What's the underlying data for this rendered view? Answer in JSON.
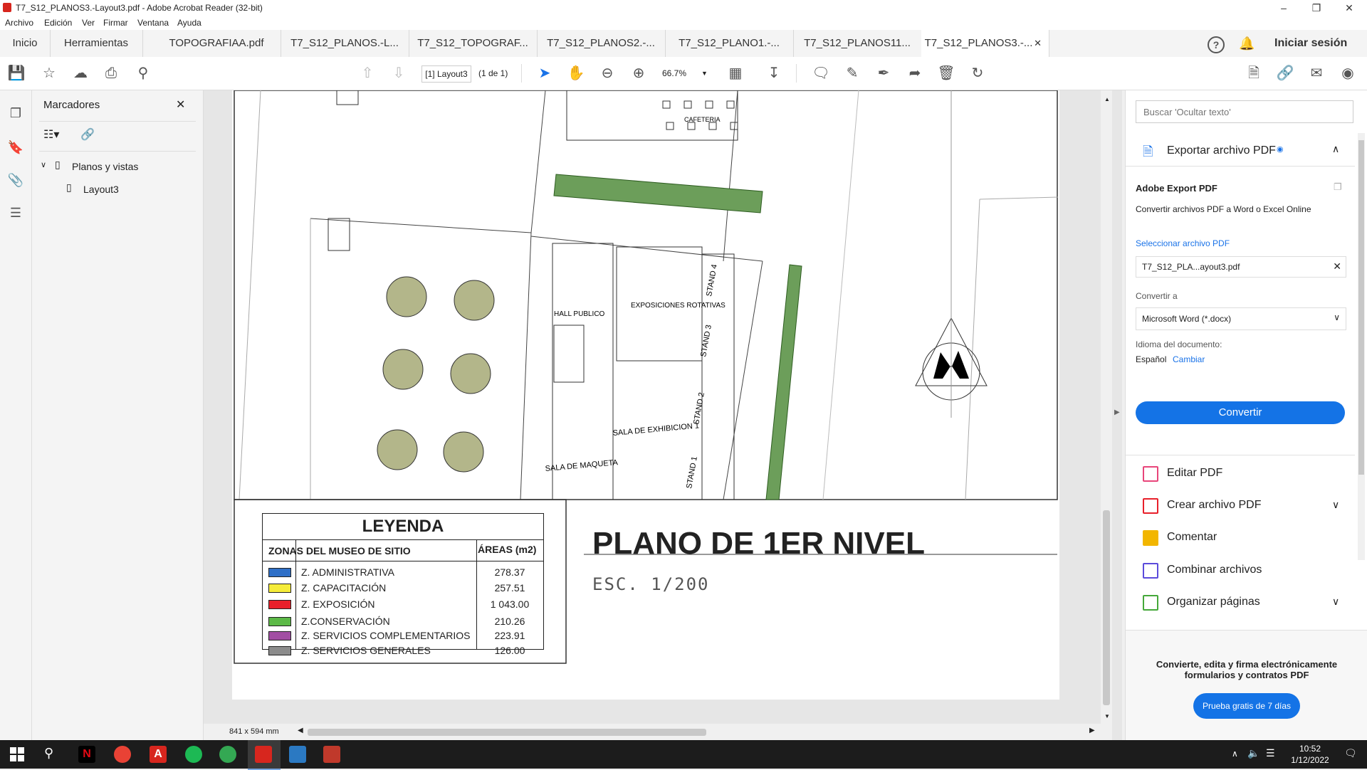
{
  "window": {
    "title": "T7_S12_PLANOS3.-Layout3.pdf - Adobe Acrobat Reader (32-bit)"
  },
  "menu": [
    "Archivo",
    "Edición",
    "Ver",
    "Firmar",
    "Ventana",
    "Ayuda"
  ],
  "tabs": [
    {
      "label": "Inicio"
    },
    {
      "label": "Herramientas"
    },
    {
      "label": "TOPOGRAFIAA.pdf"
    },
    {
      "label": "T7_S12_PLANOS.-L..."
    },
    {
      "label": "T7_S12_TOPOGRAF..."
    },
    {
      "label": "T7_S12_PLANOS2.-..."
    },
    {
      "label": "T7_S12_PLANO1.-..."
    },
    {
      "label": "T7_S12_PLANOS11..."
    },
    {
      "label": "T7_S12_PLANOS3.-..."
    }
  ],
  "header_right": {
    "signin": "Iniciar sesión"
  },
  "toolbar": {
    "page_field": "[1] Layout3",
    "page_count": "(1 de 1)",
    "zoom": "66.7%"
  },
  "bookmarks": {
    "title": "Marcadores",
    "items": [
      {
        "label": "Planos y vistas"
      },
      {
        "label": "Layout3"
      }
    ]
  },
  "plan": {
    "labels": {
      "cafeteria": "CAFETERIA",
      "hall": "HALL PUBLICO",
      "expo": "EXPOSICIONES ROTATIVAS",
      "stand4": "STAND 4",
      "stand3": "STAND 3",
      "stand2": "STAND 2",
      "stand1": "STAND 1",
      "sala_exhib": "SALA DE EXHIBICION 1",
      "sala_maqueta": "SALA DE MAQUETA"
    },
    "title": "PLANO DE 1ER NIVEL",
    "scale": "ESC. 1/200"
  },
  "legend": {
    "title": "LEYENDA",
    "col1": "ZONAS DEL MUSEO DE SITIO",
    "col2": "ÁREAS (m2)",
    "rows": [
      {
        "zone": "Z. ADMINISTRATIVA",
        "area": "278.37",
        "color": "#2e6fc7"
      },
      {
        "zone": "Z. CAPACITACIÓN",
        "area": "257.51",
        "color": "#f5ec3a"
      },
      {
        "zone": "Z. EXPOSICIÓN",
        "area": "1 043.00",
        "color": "#e8202a"
      },
      {
        "zone": "Z.CONSERVACIÓN",
        "area": "210.26",
        "color": "#5cb947"
      },
      {
        "zone": "Z. SERVICIOS COMPLEMENTARIOS",
        "area": "223.91",
        "color": "#a24ea3"
      },
      {
        "zone": "Z. SERVICIOS GENERALES",
        "area": "126.00",
        "color": "#8c8c8c"
      }
    ]
  },
  "status": {
    "page_size": "841 x 594 mm"
  },
  "right_panel": {
    "search_placeholder": "Buscar 'Ocultar texto'",
    "export_title": "Exportar archivo PDF",
    "adobe_export": "Adobe Export PDF",
    "export_desc": "Convertir archivos PDF a Word o Excel Online",
    "select_file": "Seleccionar archivo PDF",
    "file_name": "T7_S12_PLA...ayout3.pdf",
    "convert_to": "Convertir a",
    "format": "Microsoft Word (*.docx)",
    "doc_lang_label": "Idioma del documento:",
    "doc_lang": "Español",
    "change": "Cambiar",
    "convert_btn": "Convertir",
    "tools": [
      {
        "label": "Editar PDF",
        "color": "#e8457a"
      },
      {
        "label": "Crear archivo PDF",
        "color": "#e8202a"
      },
      {
        "label": "Comentar",
        "color": "#f2b600"
      },
      {
        "label": "Combinar archivos",
        "color": "#5b4bdb"
      },
      {
        "label": "Organizar páginas",
        "color": "#45a83a"
      }
    ],
    "promo": "Convierte, edita y firma electrónicamente formularios y contratos PDF",
    "trial_btn": "Prueba gratis de 7 días"
  },
  "taskbar": {
    "time": "10:52",
    "date": "1/12/2022"
  }
}
